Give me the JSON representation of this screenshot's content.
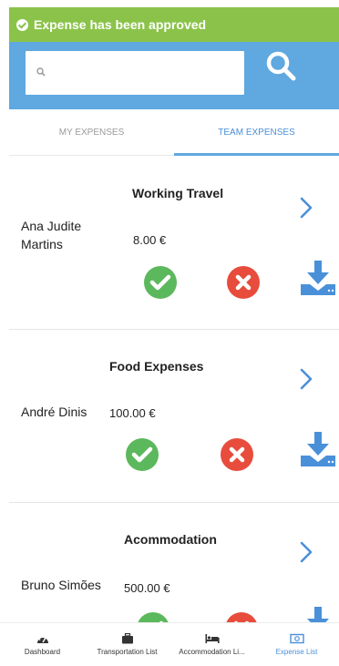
{
  "toast": {
    "message": "Expense has been approved",
    "color": "#8bc34a"
  },
  "search": {
    "placeholder": ""
  },
  "tabs": [
    {
      "label": "MY EXPENSES",
      "active": false
    },
    {
      "label": "TEAM EXPENSES",
      "active": true
    }
  ],
  "expenses": [
    {
      "title": "Working Travel",
      "employee": "Ana Judite Martins",
      "amount": "8.00 €"
    },
    {
      "title": "Food Expenses",
      "employee": "André Dinis",
      "amount": "100.00 €"
    },
    {
      "title": "Acommodation",
      "employee": "Bruno Simões",
      "amount": "500.00 €"
    }
  ],
  "bottom_nav": [
    {
      "label": "Dashboard",
      "icon": "dashboard-icon"
    },
    {
      "label": "Transportation List",
      "icon": "briefcase-icon"
    },
    {
      "label": "Accommodation Li...",
      "icon": "bed-icon"
    },
    {
      "label": "Expense List",
      "icon": "money-icon",
      "active": true
    }
  ],
  "colors": {
    "primary": "#5fa8e0",
    "approve": "#5cb85c",
    "reject": "#e74c3c",
    "success": "#8bc34a"
  }
}
